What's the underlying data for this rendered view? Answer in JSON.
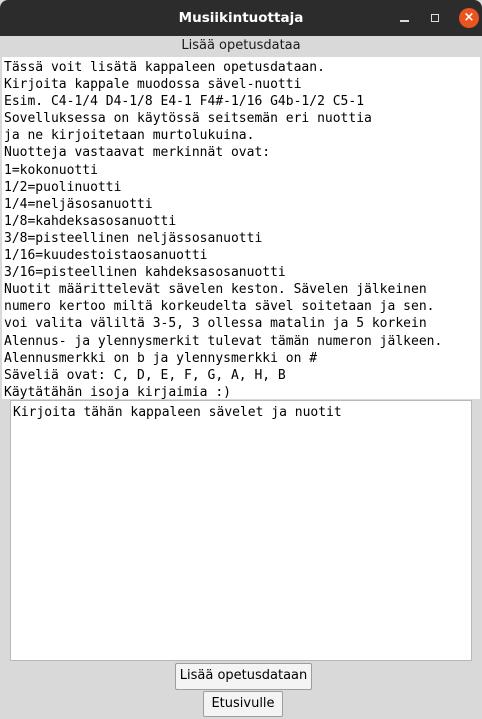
{
  "window": {
    "title": "Musiikintuottaja"
  },
  "header": {
    "label": "Lisää opetusdataa"
  },
  "instructions": [
    "Tässä voit lisätä kappaleen opetusdataan.",
    "Kirjoita kappale muodossa sävel-nuotti",
    "Esim. C4-1/4 D4-1/8 E4-1 F4#-1/16 G4b-1/2 C5-1",
    "Sovelluksessa on käytössä seitsemän eri nuottia",
    "ja ne kirjoitetaan murtolukuina.",
    "Nuotteja vastaavat merkinnät ovat:",
    "1=kokonuotti",
    "1/2=puolinuotti",
    "1/4=neljäsosanuotti",
    "1/8=kahdeksasosanuotti",
    "3/8=pisteellinen neljässosanuotti",
    "1/16=kuudestoistaosanuotti",
    "3/16=pisteellinen kahdeksasosanuotti",
    "Nuotit määrittelevät sävelen keston. Sävelen jälkeinen",
    "numero kertoo miltä korkeudelta sävel soitetaan ja sen.",
    "voi valita väliltä 3-5, 3 ollessa matalin ja 5 korkein",
    "Alennus- ja ylennysmerkit tulevat tämän numeron jälkeen.",
    "Alennusmerkki on b ja ylennysmerkki on #",
    "Säveliä ovat: C, D, E, F, G, A, H, B",
    "Käytätähän isoja kirjaimia :)"
  ],
  "input": {
    "value": "Kirjoita tähän kappaleen sävelet ja nuotit"
  },
  "buttons": {
    "add_label": "Lisää opetusdataan",
    "home_label": "Etusivulle",
    "close_symbol": "×"
  },
  "colors": {
    "titlebar": "#2c2c2c",
    "close_button": "#e95420",
    "window_bg": "#d9d9d9"
  }
}
